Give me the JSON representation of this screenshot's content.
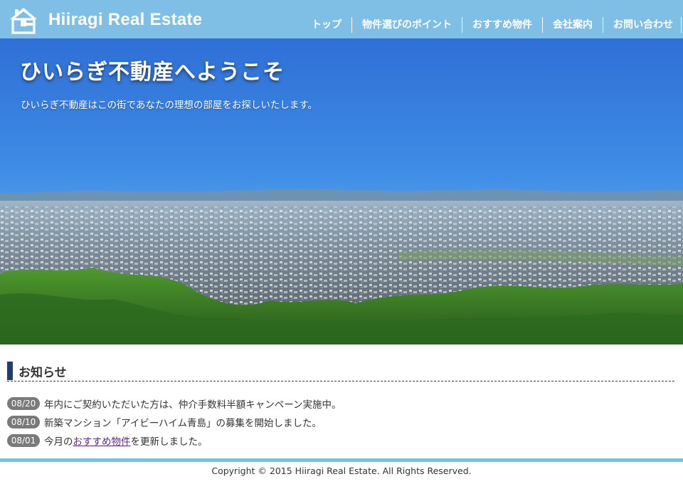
{
  "header": {
    "logo_text": "Hiiragi Real Estate",
    "logo_icon": "house-icon",
    "nav": [
      "トップ",
      "物件選びのポイント",
      "おすすめ物件",
      "会社案内",
      "お問い合わせ"
    ]
  },
  "hero": {
    "title": "ひいらぎ不動産へようこそ",
    "subtitle": "ひいらぎ不動産はこの街であなたの理想の部屋をお探しいたします。",
    "image": "city-panorama"
  },
  "news": {
    "heading": "お知らせ",
    "items": [
      {
        "date": "08/20",
        "text": "年内にご契約いただいた方は、仲介手数料半額キャンペーン実施中。"
      },
      {
        "date": "08/10",
        "text": "新築マンション「アイビーハイム青島」の募集を開始しました。"
      },
      {
        "date": "08/01",
        "before": "今月の",
        "link": "おすすめ物件",
        "after": "を更新しました。"
      }
    ]
  },
  "footer": {
    "copyright": "Copyright © 2015 Hiiragi Real Estate. All Rights Reserved."
  },
  "colors": {
    "header_bg": "#7fbfe6",
    "heading_bar": "#1e3f6e",
    "date_badge": "#7a7a7a",
    "link": "#5b2a86"
  }
}
